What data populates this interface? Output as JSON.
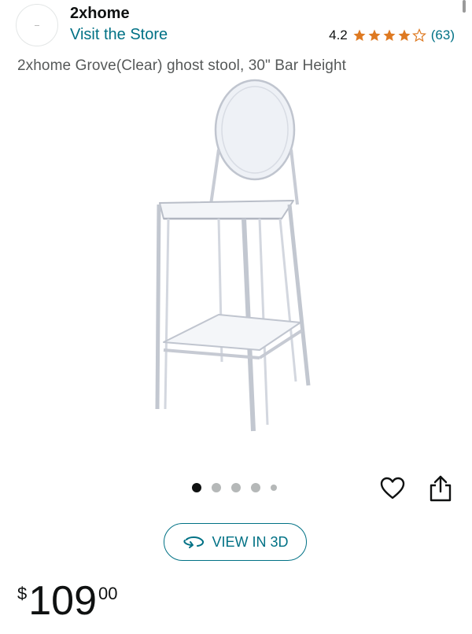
{
  "store": {
    "name": "2xhome",
    "link_label": "Visit the Store",
    "avatar_icon": "store-logo"
  },
  "rating": {
    "value": "4.2",
    "stars_filled": 4,
    "stars_total": 5,
    "count": "(63)",
    "star_color": "#de7921"
  },
  "product": {
    "title": "2xhome Grove(Clear) ghost stool, 30\" Bar Height",
    "image_icon": "ghost-bar-stool-image"
  },
  "carousel": {
    "total": 5,
    "active_index": 0
  },
  "actions": {
    "wishlist_icon": "heart-icon",
    "share_icon": "share-icon",
    "view3d_label": "VIEW IN 3D",
    "view3d_icon": "rotate-3d-icon"
  },
  "price": {
    "currency": "$",
    "whole": "109",
    "fraction": "00"
  },
  "colors": {
    "link": "#007185",
    "text": "#0f1111",
    "muted": "#565959"
  }
}
